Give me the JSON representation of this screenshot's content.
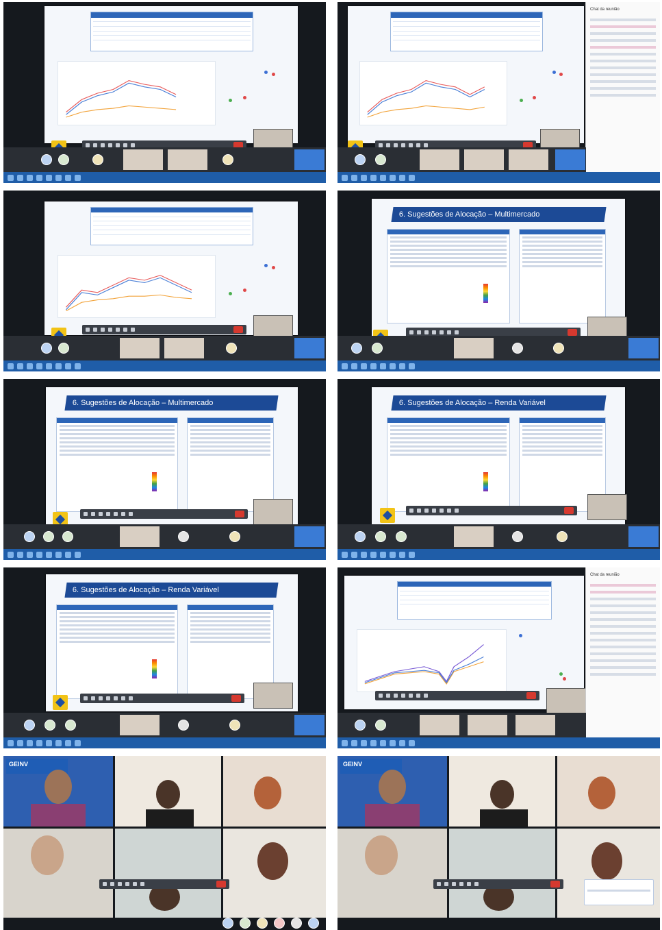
{
  "slides": {
    "multimercado_title": "6. Sugestões de Alocação – Multimercado",
    "renda_variavel_title": "6. Sugestões de Alocação – Renda Variável"
  },
  "chat": {
    "title": "Chat da reunião"
  },
  "brand": {
    "geinv": "GEINV"
  },
  "colors": {
    "slide_banner": "#1c4a96",
    "taskbar": "#1f5da8",
    "end_call": "#d6392f",
    "bb_yellow": "#f2c316"
  }
}
